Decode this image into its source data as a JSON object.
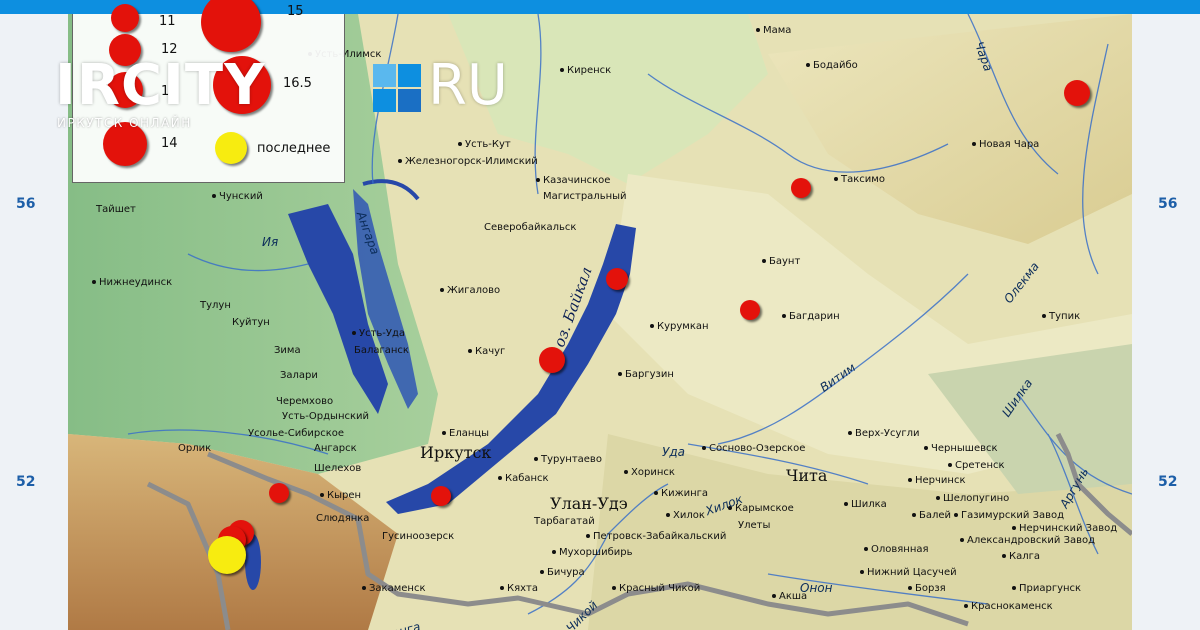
{
  "brand": {
    "name": "IRCITY",
    "ru": "RU",
    "tagline": "ИРКУТСК ОНЛАЙН",
    "sq_colors": [
      "#5ab8ee",
      "#0d8fe0",
      "#0d8fe0",
      "#1a6fc4"
    ]
  },
  "latitudes": {
    "top": "56",
    "bottom": "52"
  },
  "legend": {
    "items": [
      {
        "label": "11"
      },
      {
        "label": "12"
      },
      {
        "label": "13"
      },
      {
        "label": "14"
      },
      {
        "label": "16.5"
      },
      {
        "label": "последнее"
      }
    ],
    "extra": "15"
  },
  "colors": {
    "quake": "#e3120b",
    "last": "#f7ec10",
    "water": "#2748a8",
    "lowland": "#8fc28d",
    "highland": "#e9e3b8"
  },
  "lake": {
    "name": "оз. Байкал"
  },
  "cities": [
    {
      "name": "Усть-Илимск"
    },
    {
      "name": "Киренск"
    },
    {
      "name": "Мама"
    },
    {
      "name": "Бодайбо"
    },
    {
      "name": "Усть-Кут"
    },
    {
      "name": "Железногорск-Илимский"
    },
    {
      "name": "Казачинское"
    },
    {
      "name": "Магистральный"
    },
    {
      "name": "Новая Чара"
    },
    {
      "name": "Таксимо"
    },
    {
      "name": "Тайшет"
    },
    {
      "name": "Чунский"
    },
    {
      "name": "Северобайкальск"
    },
    {
      "name": "Баунт"
    },
    {
      "name": "Нижнеудинск"
    },
    {
      "name": "Жигалово"
    },
    {
      "name": "Тупик"
    },
    {
      "name": "Тулун"
    },
    {
      "name": "Куйтун"
    },
    {
      "name": "Усть-Уда"
    },
    {
      "name": "Курумкан"
    },
    {
      "name": "Багдарин"
    },
    {
      "name": "Балаганск"
    },
    {
      "name": "Зима"
    },
    {
      "name": "Качуг"
    },
    {
      "name": "Залари"
    },
    {
      "name": "Баргузин"
    },
    {
      "name": "Черемхово"
    },
    {
      "name": "Усть-Ордынский"
    },
    {
      "name": "Усолье-Сибирское"
    },
    {
      "name": "Еланцы"
    },
    {
      "name": "Орлик"
    },
    {
      "name": "Ангарск"
    },
    {
      "name": "Турунтаево"
    },
    {
      "name": "Шелехов"
    },
    {
      "name": "Хоринск"
    },
    {
      "name": "Кабанск"
    },
    {
      "name": "Сосново-Озерское"
    },
    {
      "name": "Верх-Усугли"
    },
    {
      "name": "Чернышевск"
    },
    {
      "name": "Кырен"
    },
    {
      "name": "Слюдянка"
    },
    {
      "name": "Кижинга"
    },
    {
      "name": "Нерчинск"
    },
    {
      "name": "Сретенск"
    },
    {
      "name": "Шелопугино"
    },
    {
      "name": "Гусиноозерск"
    },
    {
      "name": "Тарбагатай"
    },
    {
      "name": "Хилок"
    },
    {
      "name": "Карымское"
    },
    {
      "name": "Шилка"
    },
    {
      "name": "Балей"
    },
    {
      "name": "Газимурский Завод"
    },
    {
      "name": "Петровск-Забайкальский"
    },
    {
      "name": "Улеты"
    },
    {
      "name": "Нерчинский Завод"
    },
    {
      "name": "Александровский Завод"
    },
    {
      "name": "Мухоршибирь"
    },
    {
      "name": "Оловянная"
    },
    {
      "name": "Калга"
    },
    {
      "name": "Бичура"
    },
    {
      "name": "Нижний Цасучей"
    },
    {
      "name": "Закаменск"
    },
    {
      "name": "Кяхта"
    },
    {
      "name": "Красный Чикой"
    },
    {
      "name": "Борзя"
    },
    {
      "name": "Приаргунск"
    },
    {
      "name": "Акша"
    },
    {
      "name": "Краснокаменск"
    }
  ],
  "major": [
    {
      "name": "Иркутск"
    },
    {
      "name": "Улан-Удэ"
    },
    {
      "name": "Чита"
    }
  ],
  "rivers": [
    {
      "name": "Ангара"
    },
    {
      "name": "Ия"
    },
    {
      "name": "Чара"
    },
    {
      "name": "Олекма"
    },
    {
      "name": "Витим"
    },
    {
      "name": "Шилка"
    },
    {
      "name": "Аргунь"
    },
    {
      "name": "Уда"
    },
    {
      "name": "Хилок"
    },
    {
      "name": "Онон"
    },
    {
      "name": "Чикой"
    },
    {
      "name": "Селенга"
    }
  ],
  "quakes": [
    {
      "id": "q1",
      "magnitude": "13"
    },
    {
      "id": "q2",
      "magnitude": "13"
    },
    {
      "id": "q3",
      "magnitude": "13"
    },
    {
      "id": "q4",
      "magnitude": "14"
    },
    {
      "id": "q5",
      "magnitude": "13"
    },
    {
      "id": "q6",
      "magnitude": "13"
    },
    {
      "id": "q7",
      "magnitude": "13"
    },
    {
      "id": "q8",
      "magnitude": "13"
    },
    {
      "id": "q9",
      "magnitude": "14"
    },
    {
      "id": "last",
      "magnitude": "последнее"
    }
  ]
}
